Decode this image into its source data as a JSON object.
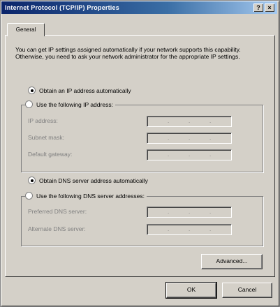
{
  "window": {
    "title": "Internet Protocol (TCP/IP) Properties",
    "help_label": "?",
    "close_label": "×"
  },
  "tabs": [
    {
      "label": "General"
    }
  ],
  "intro_text": "You can get IP settings assigned automatically if your network supports this capability. Otherwise, you need to ask your network administrator for the appropriate IP settings.",
  "ip": {
    "auto_label": "Obtain an IP address automatically",
    "manual_label": "Use the following IP address:",
    "selected": "auto",
    "fields": [
      {
        "label": "IP address:"
      },
      {
        "label": "Subnet mask:"
      },
      {
        "label": "Default gateway:"
      }
    ],
    "dots": "."
  },
  "dns": {
    "auto_label": "Obtain DNS server address automatically",
    "manual_label": "Use the following DNS server addresses:",
    "selected": "auto",
    "fields": [
      {
        "label": "Preferred DNS server:"
      },
      {
        "label": "Alternate DNS server:"
      }
    ]
  },
  "buttons": {
    "advanced": "Advanced...",
    "ok": "OK",
    "cancel": "Cancel"
  }
}
